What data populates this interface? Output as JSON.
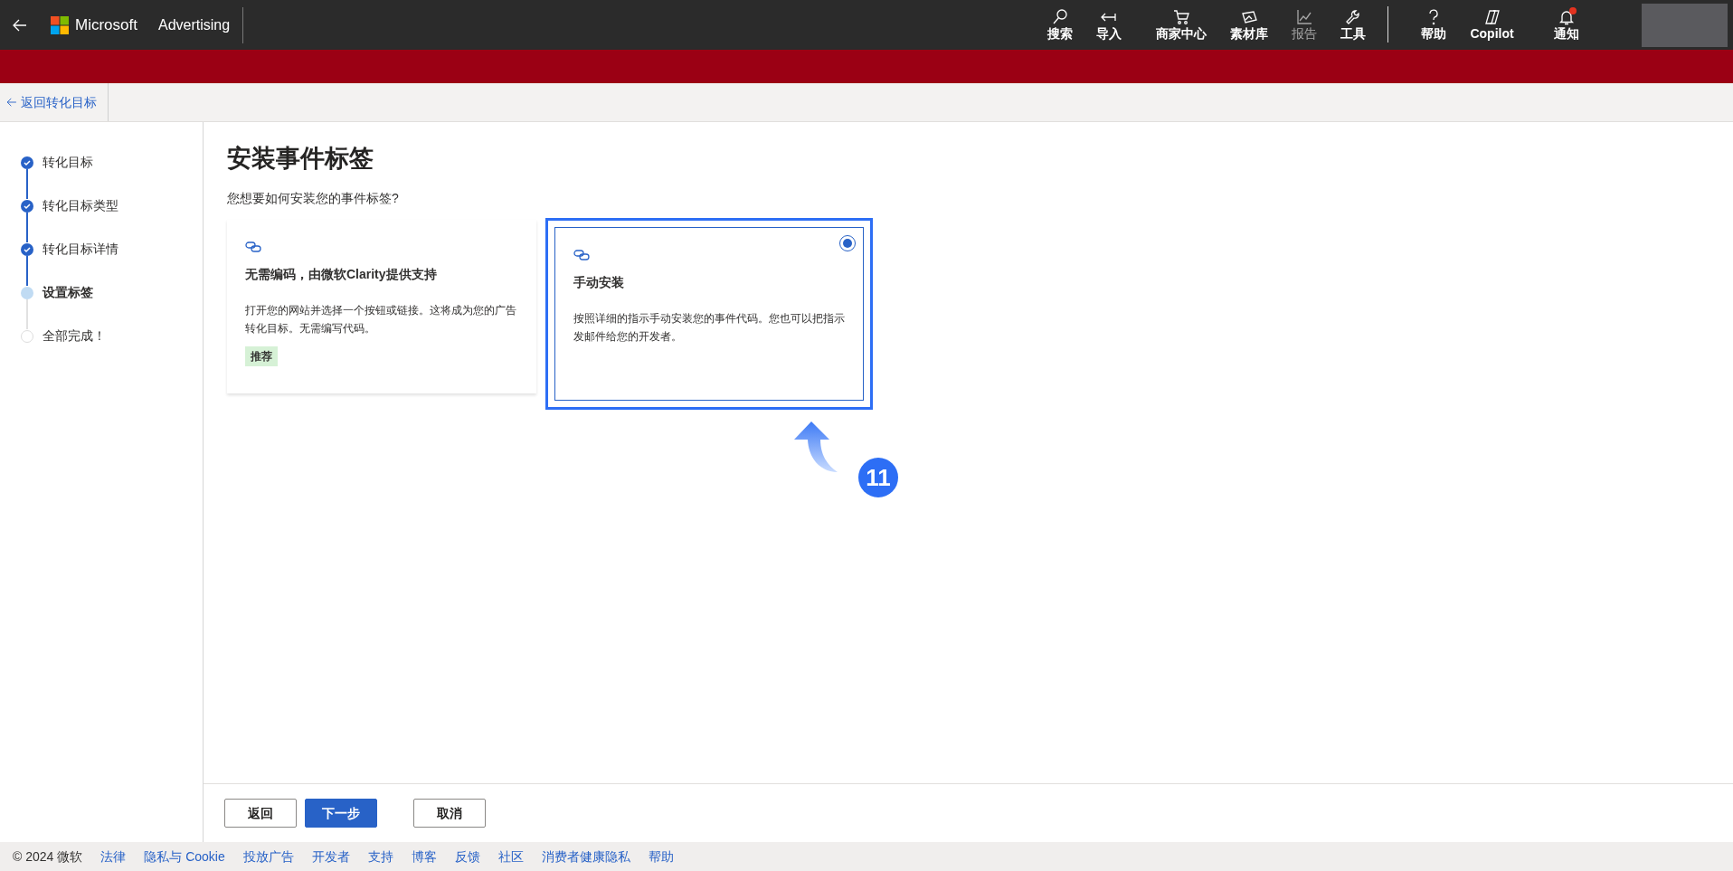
{
  "topbar": {
    "brand": "Microsoft",
    "product": "Advertising",
    "nav": [
      {
        "kind": "search",
        "label": "搜索",
        "disabled": false,
        "alert": false
      },
      {
        "kind": "import",
        "label": "导入",
        "disabled": false,
        "alert": false
      },
      {
        "kind": "cart",
        "label": "商家中心",
        "disabled": false,
        "alert": false
      },
      {
        "kind": "assets",
        "label": "素材库",
        "disabled": false,
        "alert": false
      },
      {
        "kind": "chart",
        "label": "报告",
        "disabled": true,
        "alert": false
      },
      {
        "kind": "wrench",
        "label": "工具",
        "disabled": false,
        "alert": false
      },
      {
        "kind": "help",
        "label": "帮助",
        "disabled": false,
        "alert": false
      },
      {
        "kind": "copilot",
        "label": "Copilot",
        "disabled": false,
        "alert": false
      },
      {
        "kind": "bell",
        "label": "通知",
        "disabled": false,
        "alert": true
      }
    ]
  },
  "back_link": "返回转化目标",
  "steps": [
    {
      "label": "转化目标",
      "done": true,
      "selected": false
    },
    {
      "label": "转化目标类型",
      "done": true,
      "selected": false
    },
    {
      "label": "转化目标详情",
      "done": true,
      "selected": false
    },
    {
      "label": "设置标签",
      "done": false,
      "selected": true
    },
    {
      "label": "全部完成！",
      "done": false,
      "selected": false
    }
  ],
  "page_title": "安装事件标签",
  "question": "您想要如何安装您的事件标签?",
  "options": [
    {
      "title": "无需编码，由微软Clarity提供支持",
      "description": "打开您的网站并选择一个按钮或链接。这将成为您的广告转化目标。无需编写代码。",
      "tag": "推荐",
      "selected": false
    },
    {
      "title": "手动安装",
      "description": "按照详细的指示手动安装您的事件代码。您也可以把指示发邮件给您的开发者。",
      "selected": true
    }
  ],
  "annotation": {
    "number": "11"
  },
  "buttons": [
    {
      "label": "返回",
      "kind": "secondary"
    },
    {
      "label": "下一步",
      "kind": "primary"
    },
    {
      "label": "取消",
      "kind": "secondary"
    }
  ],
  "footer": {
    "copyright": "© 2024 微软",
    "links": [
      "法律",
      "隐私与 Cookie",
      "投放广告",
      "开发者",
      "支持",
      "博客",
      "反馈",
      "社区",
      "消费者健康隐私",
      "帮助"
    ]
  }
}
